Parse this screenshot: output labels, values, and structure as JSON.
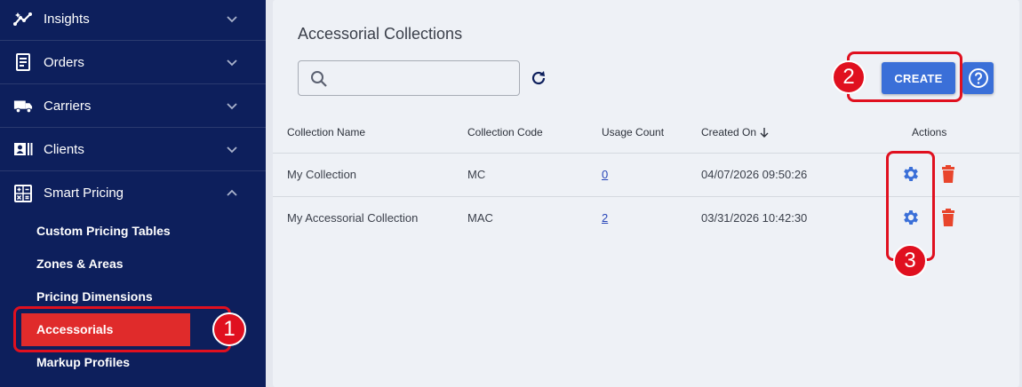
{
  "sidebar": {
    "items": [
      {
        "label": "Insights",
        "icon": "insights-icon"
      },
      {
        "label": "Orders",
        "icon": "orders-icon"
      },
      {
        "label": "Carriers",
        "icon": "truck-icon"
      },
      {
        "label": "Clients",
        "icon": "clients-icon"
      },
      {
        "label": "Smart Pricing",
        "icon": "calculator-icon"
      }
    ],
    "sub_items": [
      {
        "label": "Custom Pricing Tables"
      },
      {
        "label": "Zones & Areas"
      },
      {
        "label": "Pricing Dimensions"
      },
      {
        "label": "Accessorials",
        "active": true
      },
      {
        "label": "Markup Profiles"
      }
    ]
  },
  "main": {
    "title": "Accessorial Collections",
    "search_placeholder": "",
    "create_label": "CREATE",
    "table": {
      "columns": [
        "Collection Name",
        "Collection Code",
        "Usage Count",
        "Created On",
        "Actions"
      ],
      "sort_column": "Created On",
      "sort_direction": "descending",
      "rows": [
        {
          "name": "My Collection",
          "code": "MC",
          "usage": "0",
          "created": "04/07/2026 09:50:26"
        },
        {
          "name": "My Accessorial Collection",
          "code": "MAC",
          "usage": "2",
          "created": "03/31/2026 10:42:30"
        }
      ]
    }
  },
  "callouts": [
    "1",
    "2",
    "3"
  ],
  "colors": {
    "sidebar_bg": "#0d1f5c",
    "active_item": "#e02b2b",
    "primary": "#3a6fd8",
    "delete": "#e8452c",
    "callout": "#e0101f"
  }
}
